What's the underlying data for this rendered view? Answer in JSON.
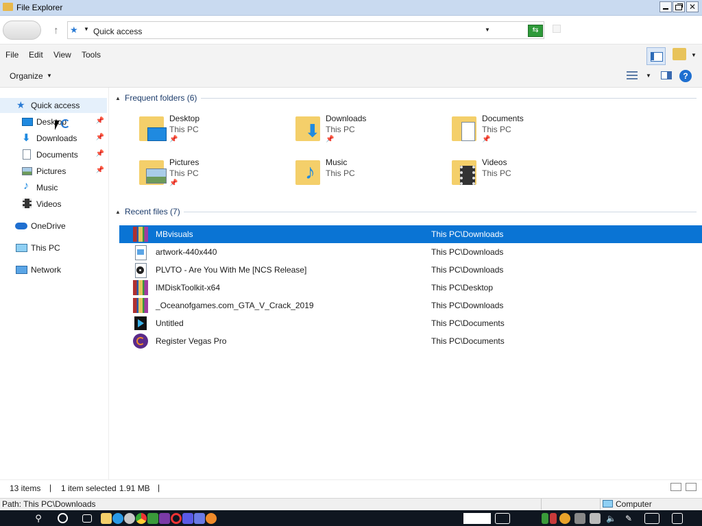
{
  "window": {
    "title": "File Explorer"
  },
  "address": {
    "location": "Quick access"
  },
  "menu": {
    "items": [
      "File",
      "Edit",
      "View",
      "Tools"
    ]
  },
  "toolbar": {
    "organize_label": "Organize"
  },
  "nav": {
    "quick_access": "Quick access",
    "items": [
      {
        "label": "Desktop",
        "pinned": true,
        "icon": "desktop-icon"
      },
      {
        "label": "Downloads",
        "pinned": true,
        "icon": "download-icon"
      },
      {
        "label": "Documents",
        "pinned": true,
        "icon": "document-icon"
      },
      {
        "label": "Pictures",
        "pinned": true,
        "icon": "picture-icon"
      },
      {
        "label": "Music",
        "pinned": false,
        "icon": "music-icon"
      },
      {
        "label": "Videos",
        "pinned": false,
        "icon": "video-icon"
      }
    ],
    "onedrive": "OneDrive",
    "this_pc": "This PC",
    "network": "Network"
  },
  "frequent": {
    "header": "Frequent folders (6)",
    "folders": [
      {
        "name": "Desktop",
        "location": "This PC",
        "icon": "desktop-folder-icon"
      },
      {
        "name": "Downloads",
        "location": "This PC",
        "icon": "downloads-folder-icon"
      },
      {
        "name": "Documents",
        "location": "This PC",
        "icon": "documents-folder-icon"
      },
      {
        "name": "Pictures",
        "location": "This PC",
        "icon": "pictures-folder-icon"
      },
      {
        "name": "Music",
        "location": "This PC",
        "icon": "music-folder-icon"
      },
      {
        "name": "Videos",
        "location": "This PC",
        "icon": "videos-folder-icon"
      }
    ]
  },
  "recent": {
    "header": "Recent files (7)",
    "files": [
      {
        "name": "MBvisuals",
        "location": "This PC\\Downloads",
        "icon": "archive-icon",
        "selected": true
      },
      {
        "name": "artwork-440x440",
        "location": "This PC\\Downloads",
        "icon": "image-file-icon",
        "selected": false
      },
      {
        "name": "PLVTO - Are You With Me [NCS Release]",
        "location": "This PC\\Downloads",
        "icon": "audio-file-icon",
        "selected": false
      },
      {
        "name": "IMDiskToolkit-x64",
        "location": "This PC\\Desktop",
        "icon": "archive-icon",
        "selected": false
      },
      {
        "name": "_Oceanofgames.com_GTA_V_Crack_2019",
        "location": "This PC\\Downloads",
        "icon": "archive-icon",
        "selected": false
      },
      {
        "name": "Untitled",
        "location": "This PC\\Documents",
        "icon": "media-file-icon",
        "selected": false
      },
      {
        "name": "Register Vegas Pro",
        "location": "This PC\\Documents",
        "icon": "vegas-icon",
        "selected": false
      }
    ]
  },
  "status": {
    "items": "13 items",
    "selected": "1 item selected",
    "size": "1.91 MB",
    "path": "Path: This PC\\Downloads",
    "zone": "Computer"
  },
  "colors": {
    "selection": "#0a74d4",
    "titlebar": "#c9daf0",
    "taskbar": "#0f1620"
  }
}
